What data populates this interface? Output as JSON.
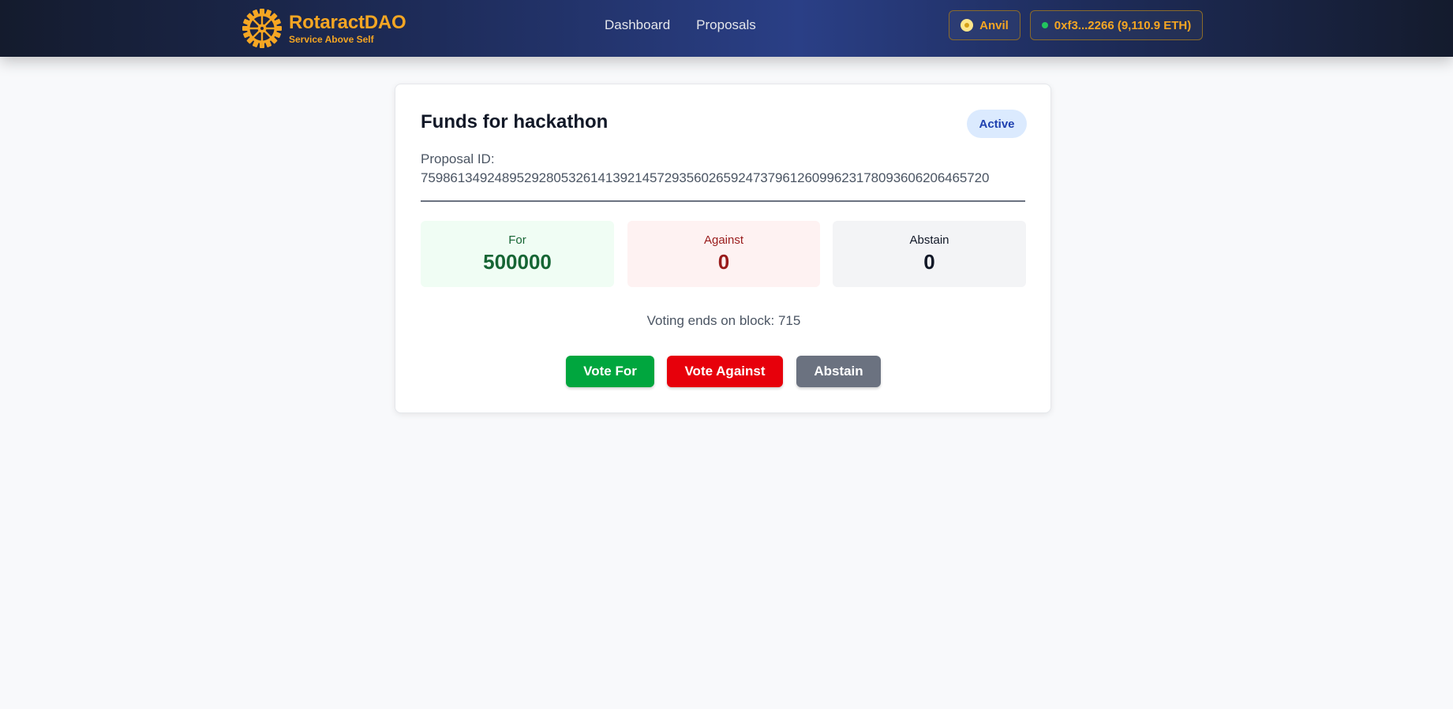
{
  "brand": {
    "name": "RotaractDAO",
    "tagline": "Service Above Self",
    "color": "#f5a623"
  },
  "nav": {
    "links": [
      "Dashboard",
      "Proposals"
    ]
  },
  "network": {
    "label": "Anvil"
  },
  "wallet": {
    "label": "0xf3...2266 (9,110.9 ETH)",
    "status_color": "#22c55e"
  },
  "proposal": {
    "title": "Funds for hackathon",
    "status": "Active",
    "id_label": "Proposal ID:",
    "id_value": "75986134924895292805326141392145729356026592473796126099623178093606206465720",
    "tally": {
      "for": {
        "label": "For",
        "count": "500000",
        "color": "#166534"
      },
      "against": {
        "label": "Against",
        "count": "0",
        "color": "#991b1b"
      },
      "abstain": {
        "label": "Abstain",
        "count": "0",
        "color": "#111827"
      }
    },
    "voting_ends": "Voting ends on block: 715",
    "buttons": {
      "for": "Vote For",
      "against": "Vote Against",
      "abstain": "Abstain"
    }
  }
}
